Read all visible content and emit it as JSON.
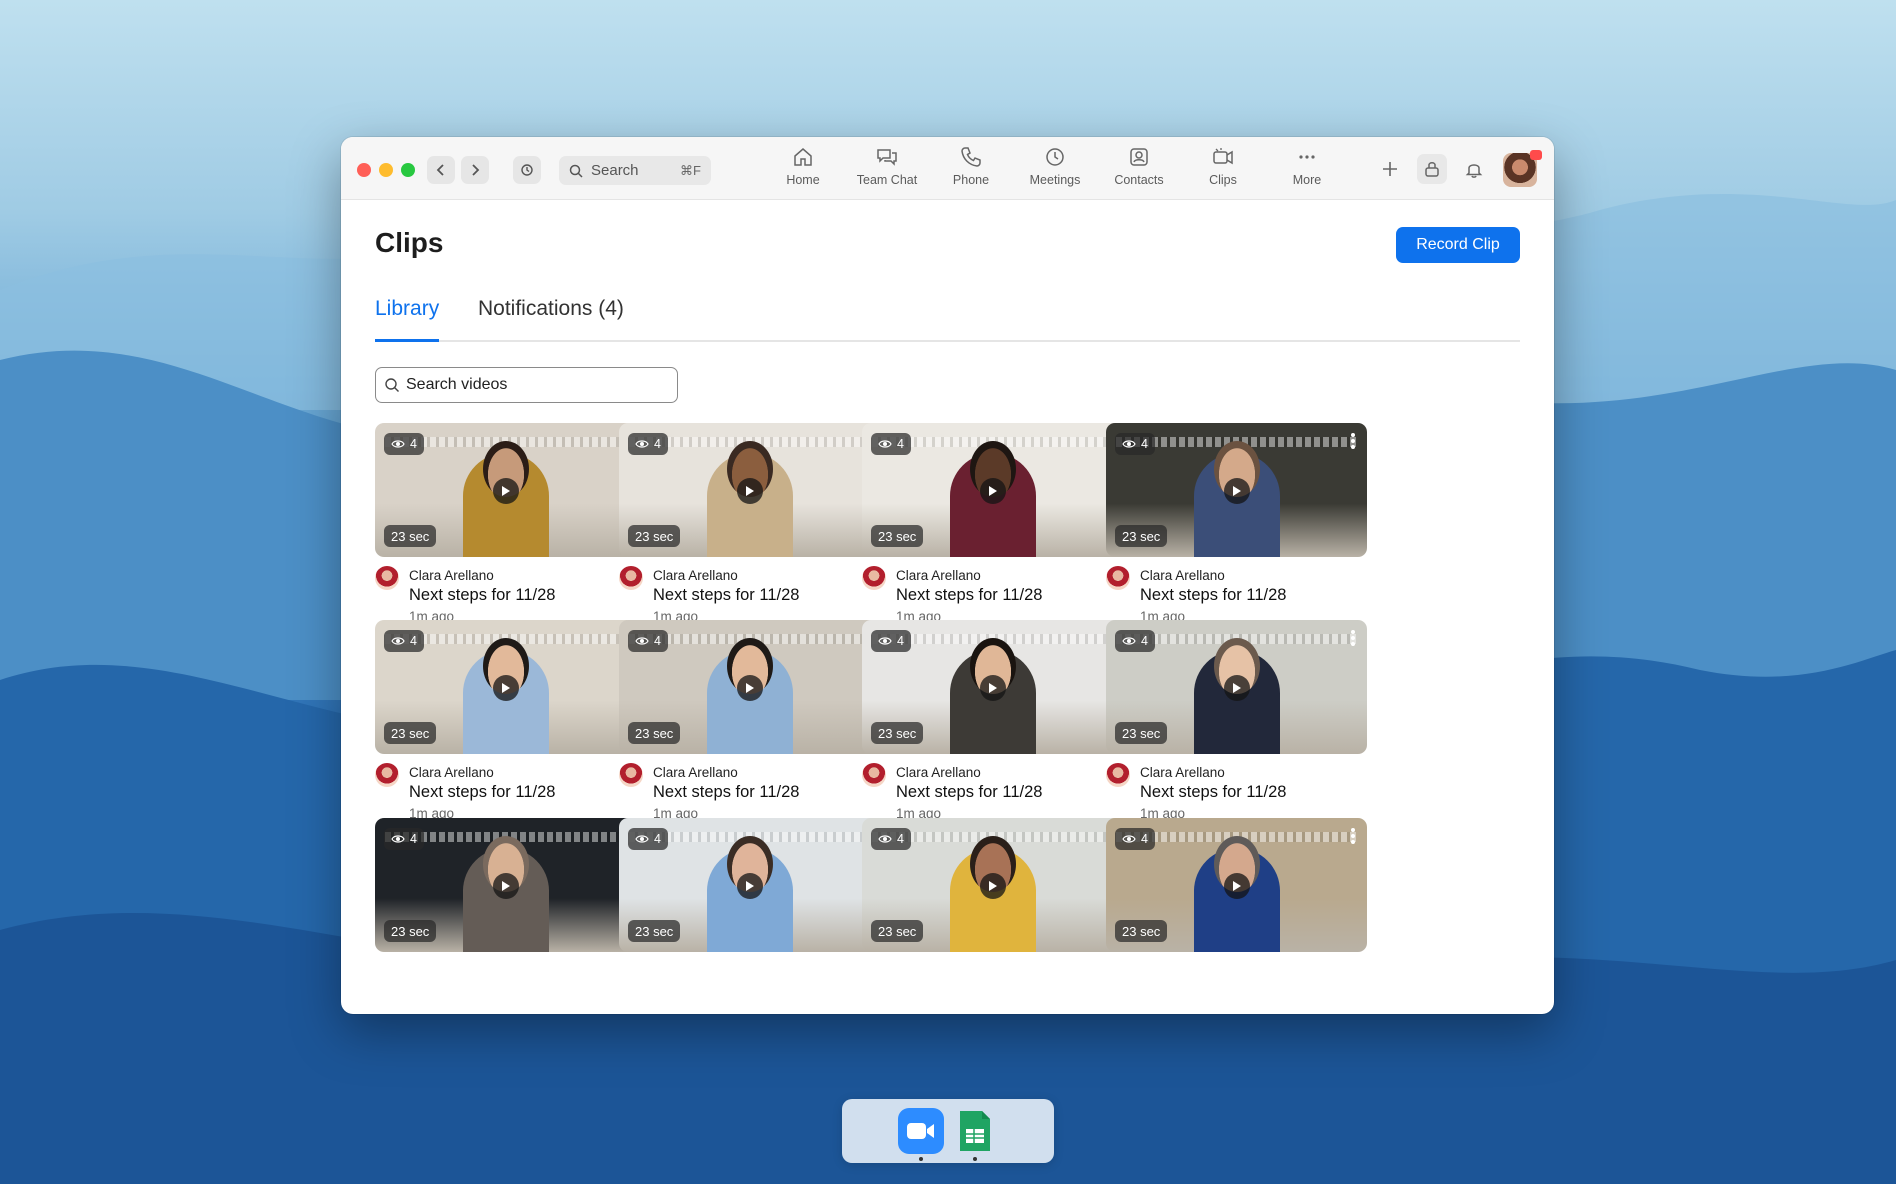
{
  "window": {
    "search_placeholder": "Search",
    "search_shortcut": "⌘F",
    "nav": [
      {
        "label": "Home",
        "icon": "home-icon"
      },
      {
        "label": "Team Chat",
        "icon": "chat-icon"
      },
      {
        "label": "Phone",
        "icon": "phone-icon"
      },
      {
        "label": "Meetings",
        "icon": "clock-icon"
      },
      {
        "label": "Contacts",
        "icon": "contacts-icon"
      },
      {
        "label": "Clips",
        "icon": "clips-icon"
      },
      {
        "label": "More",
        "icon": "more-icon"
      }
    ]
  },
  "page": {
    "title": "Clips",
    "record_button": "Record Clip",
    "tabs": [
      "Library",
      "Notifications (4)"
    ],
    "active_tab": "Library",
    "search_placeholder": "Search videos"
  },
  "clips": [
    {
      "views": "4",
      "duration": "23 sec",
      "owner": "Clara Arellano",
      "title": "Next steps for 11/28",
      "ago": "1m ago"
    },
    {
      "views": "4",
      "duration": "23 sec",
      "owner": "Clara Arellano",
      "title": "Next steps for 11/28",
      "ago": "1m ago"
    },
    {
      "views": "4",
      "duration": "23 sec",
      "owner": "Clara Arellano",
      "title": "Next steps for 11/28",
      "ago": "1m ago"
    },
    {
      "views": "4",
      "duration": "23 sec",
      "owner": "Clara Arellano",
      "title": "Next steps for 11/28",
      "ago": "1m ago"
    },
    {
      "views": "4",
      "duration": "23 sec",
      "owner": "Clara Arellano",
      "title": "Next steps for 11/28",
      "ago": "1m ago"
    },
    {
      "views": "4",
      "duration": "23 sec",
      "owner": "Clara Arellano",
      "title": "Next steps for 11/28",
      "ago": "1m ago"
    },
    {
      "views": "4",
      "duration": "23 sec",
      "owner": "Clara Arellano",
      "title": "Next steps for 11/28",
      "ago": "1m ago"
    },
    {
      "views": "4",
      "duration": "23 sec",
      "owner": "Clara Arellano",
      "title": "Next steps for 11/28",
      "ago": "1m ago"
    },
    {
      "views": "4",
      "duration": "23 sec"
    },
    {
      "views": "4",
      "duration": "23 sec"
    },
    {
      "views": "4",
      "duration": "23 sec"
    },
    {
      "views": "4",
      "duration": "23 sec"
    }
  ],
  "colors": {
    "accent": "#0e72ed",
    "desktop": "#2f74b8"
  },
  "dock": [
    "zoom-app-icon",
    "sheets-app-icon"
  ]
}
